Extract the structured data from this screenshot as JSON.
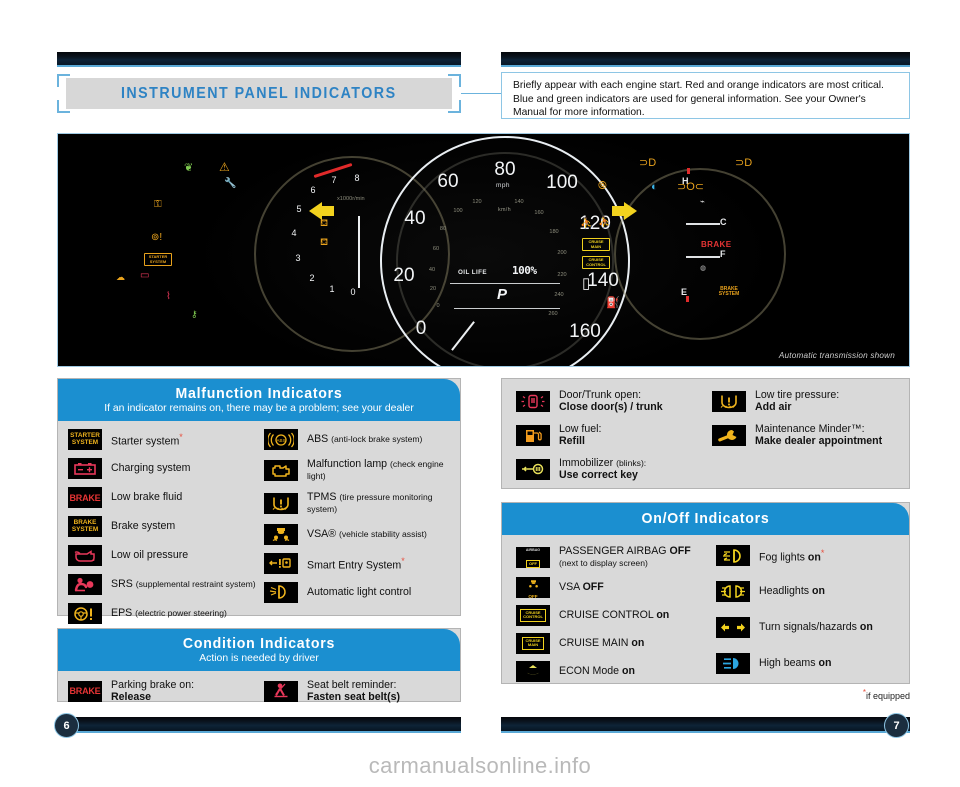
{
  "header": {
    "title": "INSTRUMENT PANEL INDICATORS",
    "intro": "Briefly appear with each engine start. Red and orange indicators are most critical. Blue and green indicators are used for general information. See your Owner's Manual for more information."
  },
  "photo": {
    "caption": "Automatic transmission shown",
    "speedometer": {
      "unit_primary": "mph",
      "unit_secondary": "km/h",
      "mph_ticks": [
        "0",
        "20",
        "40",
        "60",
        "80",
        "100",
        "120",
        "140",
        "160"
      ],
      "kmh_ticks": [
        "0",
        "20",
        "40",
        "60",
        "80",
        "100",
        "120",
        "140",
        "160",
        "180",
        "200",
        "220",
        "240",
        "260"
      ]
    },
    "tachometer": {
      "unit": "x1000r/min",
      "ticks": [
        "0",
        "1",
        "2",
        "3",
        "4",
        "5",
        "6",
        "7",
        "8"
      ]
    },
    "display": {
      "oil_life_label": "OIL LIFE",
      "oil_life_value": "100%",
      "gear": "P"
    },
    "gauges": {
      "temp_hot": "H",
      "temp_cold": "C",
      "fuel_full": "F",
      "fuel_empty": "E",
      "brake_word": "BRAKE",
      "brake_system": "BRAKE SYSTEM"
    },
    "cluster_badges": [
      "STARTER SYSTEM",
      "CRUISE MAIN",
      "CRUISE CONTROL"
    ]
  },
  "malfunction": {
    "title": "Malfunction Indicators",
    "subtitle": "If an indicator remains on, there may be a problem; see your dealer",
    "left": [
      {
        "icon": "starter-system-icon",
        "label": "Starter system",
        "note": "",
        "starred": true
      },
      {
        "icon": "battery-icon",
        "label": "Charging system",
        "note": "",
        "starred": false
      },
      {
        "icon": "brake-icon",
        "label": "Low brake fluid",
        "note": "",
        "starred": false
      },
      {
        "icon": "brake-system-icon",
        "label": "Brake system",
        "note": "",
        "starred": false
      },
      {
        "icon": "oil-can-icon",
        "label": "Low oil pressure",
        "note": "",
        "starred": false
      },
      {
        "icon": "srs-airbag-icon",
        "label": "SRS",
        "note": "(supplemental restraint system)",
        "starred": false
      },
      {
        "icon": "eps-steering-icon",
        "label": "EPS",
        "note": "(electric power steering)",
        "starred": false
      }
    ],
    "right": [
      {
        "icon": "abs-icon",
        "label": "ABS",
        "note": "(anti-lock brake system)",
        "starred": false
      },
      {
        "icon": "check-engine-icon",
        "label": "Malfunction lamp",
        "note": "(check engine light)",
        "starred": false
      },
      {
        "icon": "tpms-icon",
        "label": "TPMS",
        "note": "(tire pressure monitoring system)",
        "starred": false
      },
      {
        "icon": "vsa-icon",
        "label": "VSA®",
        "note": "(vehicle stability assist)",
        "starred": false
      },
      {
        "icon": "smart-entry-icon",
        "label": "Smart Entry System",
        "note": "",
        "starred": true
      },
      {
        "icon": "auto-light-icon",
        "label": "Automatic light control",
        "note": "",
        "starred": false
      }
    ]
  },
  "condition": {
    "title": "Condition Indicators",
    "subtitle": "Action is needed by driver",
    "items": [
      {
        "icon": "brake-icon",
        "line1": "Parking brake on:",
        "line2": "Release"
      },
      {
        "icon": "seatbelt-icon",
        "line1": "Seat belt reminder:",
        "line2": "Fasten seat belt(s)"
      }
    ]
  },
  "info": {
    "left": [
      {
        "icon": "door-open-icon",
        "line1": "Door/Trunk open:",
        "line2": "Close door(s) / trunk"
      },
      {
        "icon": "fuel-pump-icon",
        "line1": "Low fuel:",
        "line2": "Refill"
      },
      {
        "icon": "immobilizer-key-icon",
        "line1": "Immobilizer",
        "line1_note": "(blinks):",
        "line2": "Use correct key"
      }
    ],
    "right": [
      {
        "icon": "tpms-icon",
        "line1": "Low tire pressure:",
        "line2": "Add air"
      },
      {
        "icon": "wrench-icon",
        "line1": "Maintenance Minder™:",
        "line2": "Make dealer appointment"
      }
    ]
  },
  "onoff": {
    "title": "On/Off Indicators",
    "left": [
      {
        "icon": "passenger-airbag-off-icon",
        "label": "PASSENGER AIRBAG ",
        "bold": "OFF",
        "note": "(next to display screen)",
        "starred": false
      },
      {
        "icon": "vsa-off-icon",
        "label": "VSA ",
        "bold": "OFF",
        "note": "",
        "starred": false
      },
      {
        "icon": "cruise-control-icon",
        "label": "CRUISE CONTROL ",
        "bold": "on",
        "note": "",
        "starred": false
      },
      {
        "icon": "cruise-main-icon",
        "label": "CRUISE MAIN ",
        "bold": "on",
        "note": "",
        "starred": false
      },
      {
        "icon": "econ-mode-icon",
        "label": "ECON Mode ",
        "bold": "on",
        "note": "",
        "starred": false
      }
    ],
    "right": [
      {
        "icon": "fog-light-icon",
        "label": "Fog lights ",
        "bold": "on",
        "note": "",
        "starred": true
      },
      {
        "icon": "headlight-icon",
        "label": "Headlights ",
        "bold": "on",
        "note": "",
        "starred": false
      },
      {
        "icon": "turn-signal-icon",
        "label": "Turn signals/hazards ",
        "bold": "on",
        "note": "",
        "starred": false
      },
      {
        "icon": "high-beam-icon",
        "label": "High beams ",
        "bold": "on",
        "note": "",
        "starred": false
      }
    ]
  },
  "footer": {
    "if_equipped": "if equipped",
    "page_left": "6",
    "page_right": "7",
    "watermark": "carmanualsonline.info"
  }
}
